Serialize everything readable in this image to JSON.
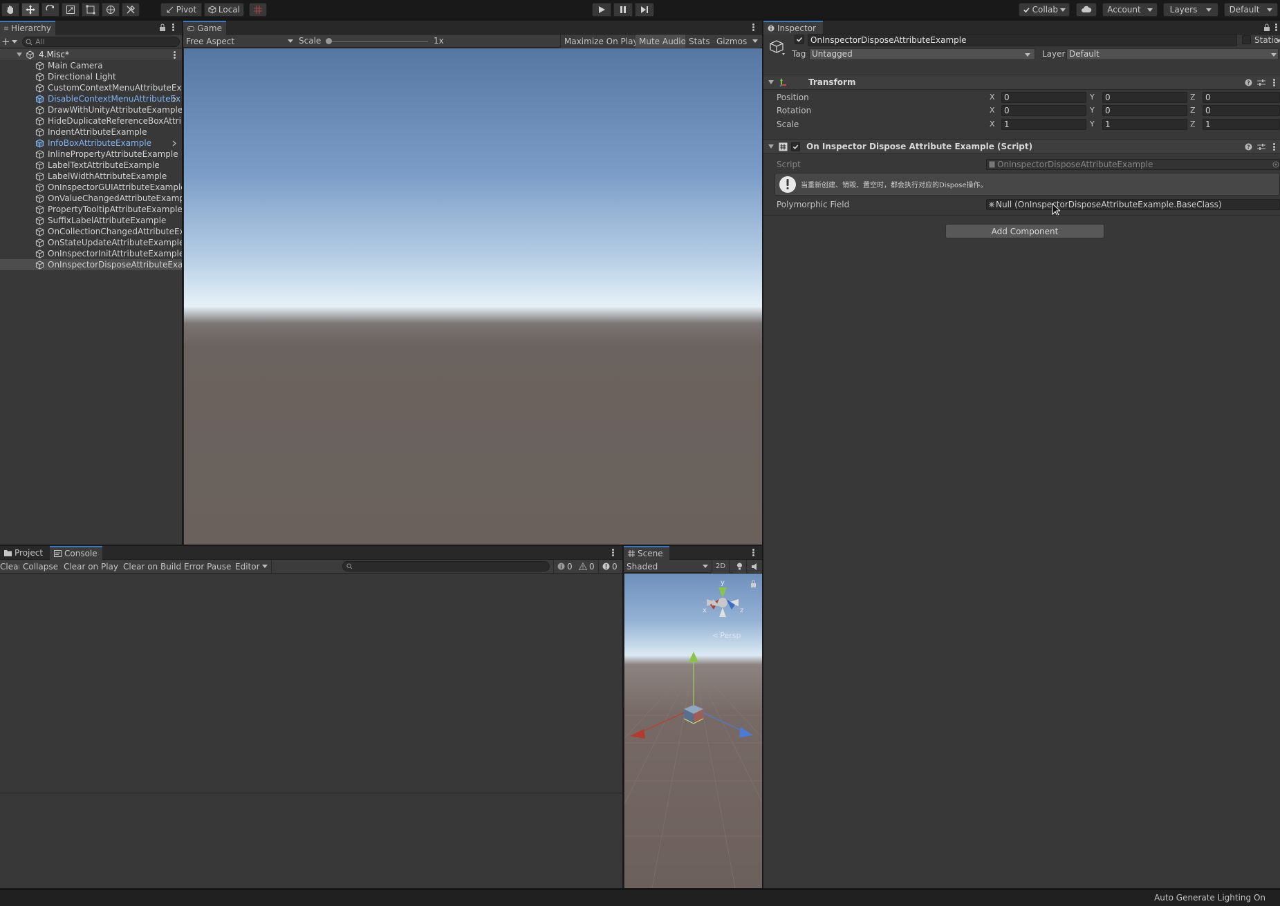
{
  "toolbar": {
    "tools": [
      "hand-tool-icon",
      "move-tool-icon",
      "rotate-tool-icon",
      "scale-tool-icon",
      "rect-tool-icon",
      "transform-tool-icon",
      "custom-tool-icon"
    ],
    "pivot_label": "Pivot",
    "local_label": "Local",
    "collab_label": "Collab",
    "account_label": "Account",
    "layers_label": "Layers",
    "layout_label": "Default"
  },
  "hierarchy": {
    "tab_label": "Hierarchy",
    "search_placeholder": "All",
    "scene_name": "4.Misc*",
    "items": [
      {
        "label": "Main Camera",
        "style": "normal"
      },
      {
        "label": "Directional Light",
        "style": "normal"
      },
      {
        "label": "CustomContextMenuAttributeExam",
        "style": "normal"
      },
      {
        "label": "DisableContextMenuAttributeEx",
        "style": "blue",
        "expand": true
      },
      {
        "label": "DrawWithUnityAttributeExample",
        "style": "normal"
      },
      {
        "label": "HideDuplicateReferenceBoxAttribu",
        "style": "normal"
      },
      {
        "label": "IndentAttributeExample",
        "style": "normal"
      },
      {
        "label": "InfoBoxAttributeExample",
        "style": "blue",
        "expand": true
      },
      {
        "label": "InlinePropertyAttributeExample",
        "style": "normal"
      },
      {
        "label": "LabelTextAttributeExample",
        "style": "normal"
      },
      {
        "label": "LabelWidthAttributeExample",
        "style": "normal"
      },
      {
        "label": "OnInspectorGUIAttributeExample",
        "style": "normal"
      },
      {
        "label": "OnValueChangedAttributeExample",
        "style": "normal"
      },
      {
        "label": "PropertyTooltipAttributeExample",
        "style": "normal"
      },
      {
        "label": "SuffixLabelAttributeExample",
        "style": "normal"
      },
      {
        "label": "OnCollectionChangedAttributeExar",
        "style": "normal"
      },
      {
        "label": "OnStateUpdateAttributeExample",
        "style": "normal"
      },
      {
        "label": "OnInspectorInitAttributeExample",
        "style": "normal"
      },
      {
        "label": "OnInspectorDisposeAttributeExamp",
        "style": "selected"
      }
    ]
  },
  "game": {
    "tab_label": "Game",
    "aspect_label": "Free Aspect",
    "scale_label": "Scale",
    "scale_value": "1x",
    "maximize_label": "Maximize On Play",
    "mute_label": "Mute Audio",
    "stats_label": "Stats",
    "gizmos_label": "Gizmos"
  },
  "inspector": {
    "tab_label": "Inspector",
    "object_name": "OnInspectorDisposeAttributeExample",
    "static_label": "Static",
    "tag_label": "Tag",
    "tag_value": "Untagged",
    "layer_label": "Layer",
    "layer_value": "Default",
    "transform": {
      "title": "Transform",
      "rows": [
        {
          "label": "Position",
          "x": "0",
          "y": "0",
          "z": "0"
        },
        {
          "label": "Rotation",
          "x": "0",
          "y": "0",
          "z": "0"
        },
        {
          "label": "Scale",
          "x": "1",
          "y": "1",
          "z": "1"
        }
      ],
      "axis_x": "X",
      "axis_y": "Y",
      "axis_z": "Z"
    },
    "script_component": {
      "title": "On Inspector Dispose Attribute Example (Script)",
      "script_label": "Script",
      "script_value": "OnInspectorDisposeAttributeExample",
      "info_text": "当重新创建、销毁、置空时，都会执行对应的Dispose操作。",
      "poly_label": "Polymorphic Field",
      "poly_value": "Null (OnInspectorDisposeAttributeExample.BaseClass)"
    },
    "add_component_label": "Add Component"
  },
  "console": {
    "project_tab": "Project",
    "console_tab": "Console",
    "clear_label": "Clear",
    "collapse_label": "Collapse",
    "clear_on_play_label": "Clear on Play",
    "clear_on_build_label": "Clear on Build",
    "error_pause_label": "Error Pause",
    "editor_label": "Editor",
    "info_count": "0",
    "warning_count": "0",
    "error_count": "0"
  },
  "scene": {
    "tab_label": "Scene",
    "shading_label": "Shaded",
    "twod_label": "2D",
    "persp_label": "Persp",
    "axis_y": "y",
    "axis_x": "x",
    "axis_z": "z"
  },
  "statusbar": {
    "text": "Auto Generate Lighting On"
  },
  "colors": {
    "accent": "#3a79bb",
    "prefab_blue": "#7fb3f2",
    "panel": "#383838",
    "field": "#2a2a2a"
  }
}
